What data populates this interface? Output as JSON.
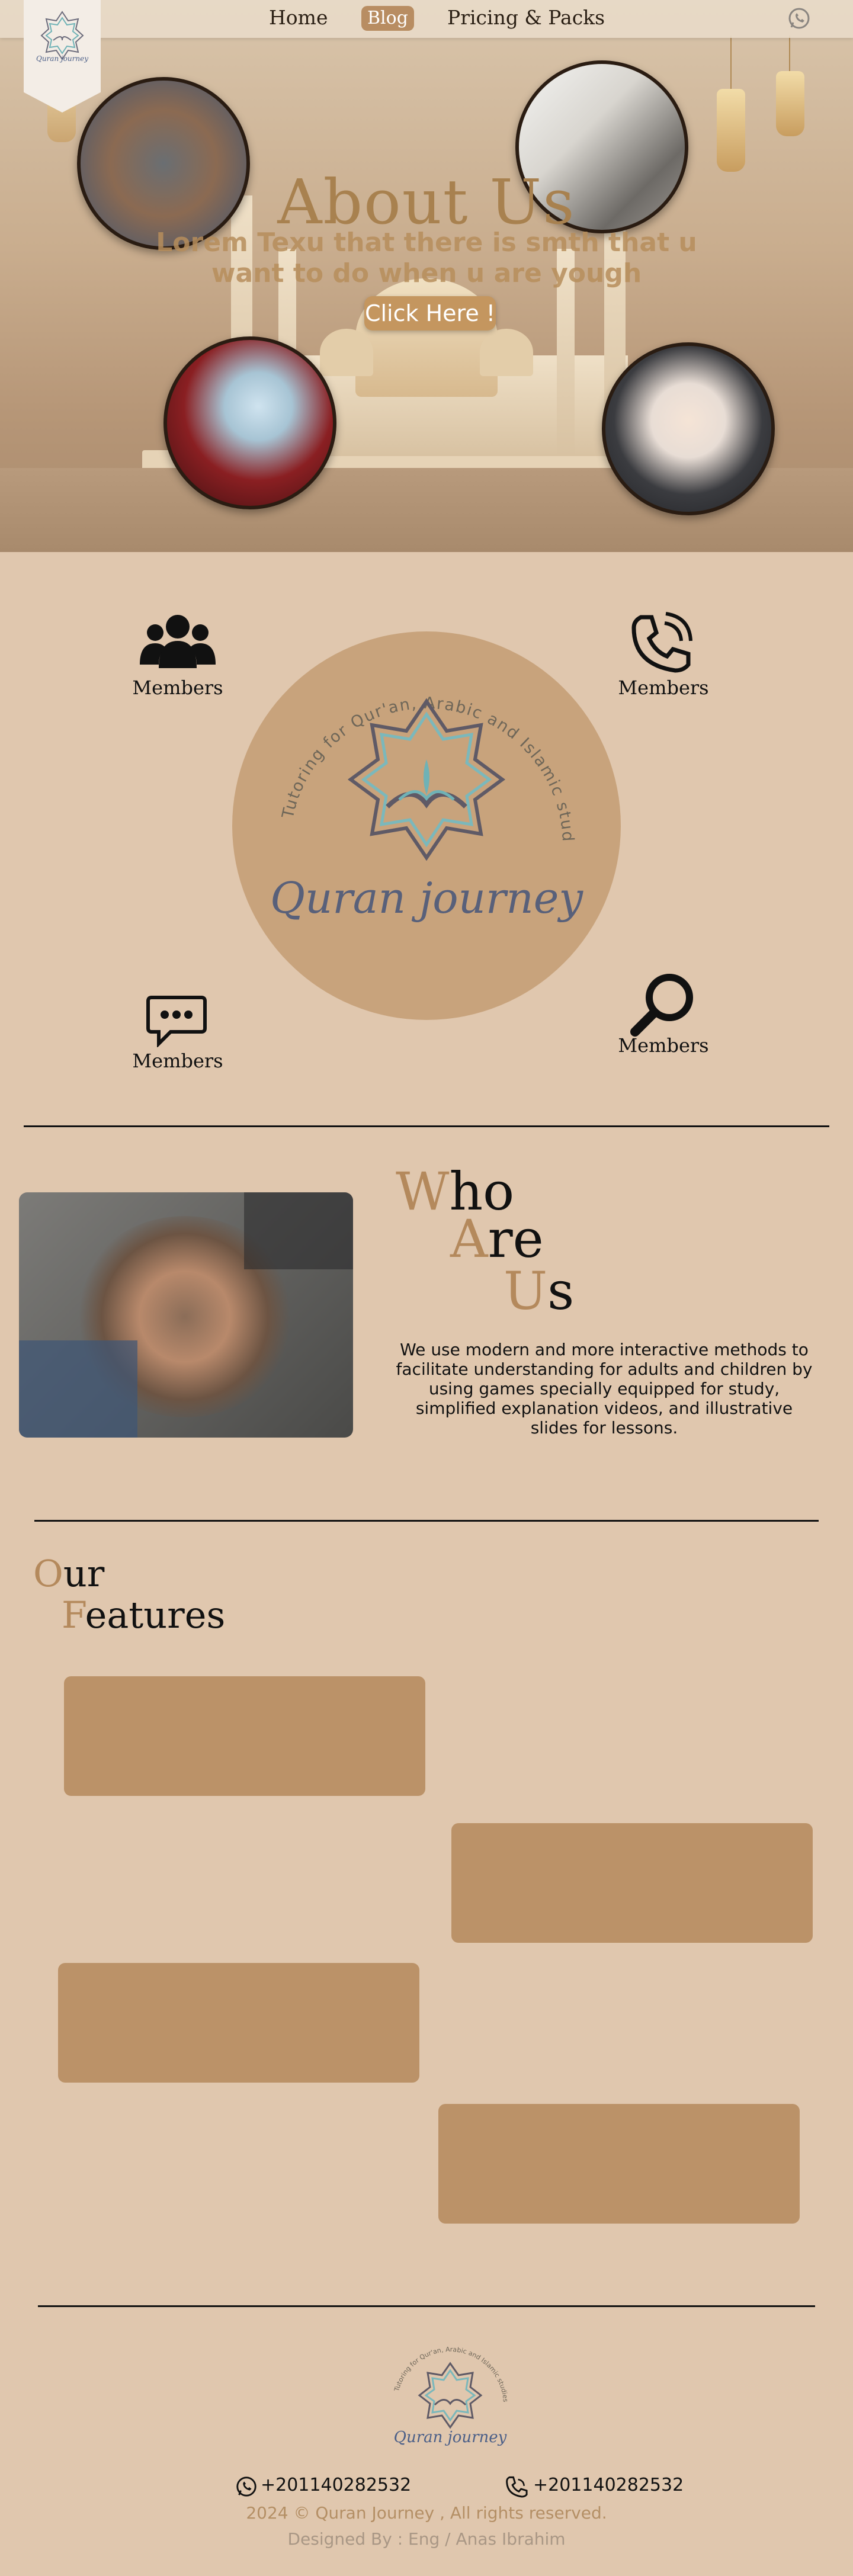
{
  "nav": {
    "home": "Home",
    "blog": "Blog",
    "pricing": "Pricing & Packs",
    "whatsapp_icon": "whatsapp-icon"
  },
  "logo": {
    "arc_text": "Tutoring for Qur'an, Arabic and Islamic studies",
    "brand": "Quran journey"
  },
  "hero": {
    "title": "About Us",
    "subtitle": "Lorem Texu that there is smth that u want to do when u are yough",
    "button": "Click Here !"
  },
  "members": {
    "items": [
      {
        "icon": "users-icon",
        "label": "Members"
      },
      {
        "icon": "phone-icon",
        "label": "Members"
      },
      {
        "icon": "chat-icon",
        "label": "Members"
      },
      {
        "icon": "search-icon",
        "label": "Members"
      }
    ]
  },
  "who": {
    "w_first": "W",
    "w_rest": "ho",
    "a_first": "A",
    "a_rest": "re",
    "u_first": "U",
    "u_rest": "s",
    "text": "We use modern and more interactive methods to facilitate understanding for adults and children by using games specially equipped for study, simplified explanation videos, and illustrative slides for lessons."
  },
  "features": {
    "o_first": "O",
    "o_rest": "ur",
    "f_first": "F",
    "f_rest": "eatures"
  },
  "footer": {
    "phone1": "+201140282532",
    "phone2": "+201140282532",
    "copyright": "2024 © Quran Journey , All rights reserved.",
    "designer": "Designed By : Eng / Anas Ibrahim"
  },
  "colors": {
    "background": "#e0c7ae",
    "accent": "#b88d62",
    "feature_box": "#bb9268",
    "circle": "#c8a37c"
  }
}
